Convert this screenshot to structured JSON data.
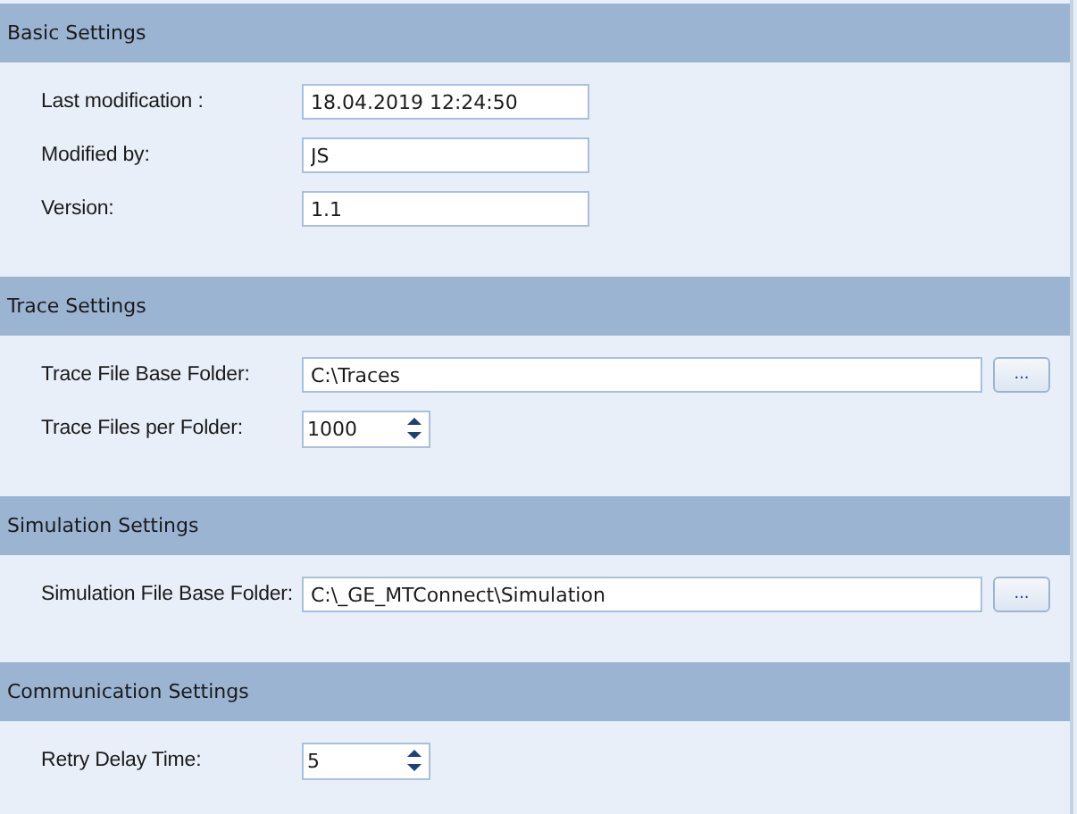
{
  "sections": [
    {
      "title": "Basic Settings",
      "fields": [
        {
          "kind": "text",
          "label": "Last modification :",
          "value": "18.04.2019 12:24:50"
        },
        {
          "kind": "text",
          "label": "Modified by:",
          "value": "JS"
        },
        {
          "kind": "text",
          "label": "Version:",
          "value": "1.1"
        }
      ]
    },
    {
      "title": "Trace Settings",
      "fields": [
        {
          "kind": "folder",
          "label": "Trace File Base Folder:",
          "value": "C:\\Traces",
          "button": "..."
        },
        {
          "kind": "spinner",
          "label": "Trace Files per Folder:",
          "value": "1000"
        }
      ]
    },
    {
      "title": "Simulation Settings",
      "fields": [
        {
          "kind": "folder",
          "label": "Simulation File Base Folder:",
          "value": "C:\\_GE_MTConnect\\Simulation",
          "button": "..."
        }
      ]
    },
    {
      "title": "Communication Settings",
      "fields": [
        {
          "kind": "spinner",
          "label": "Retry Delay Time:",
          "value": "5"
        }
      ]
    }
  ]
}
